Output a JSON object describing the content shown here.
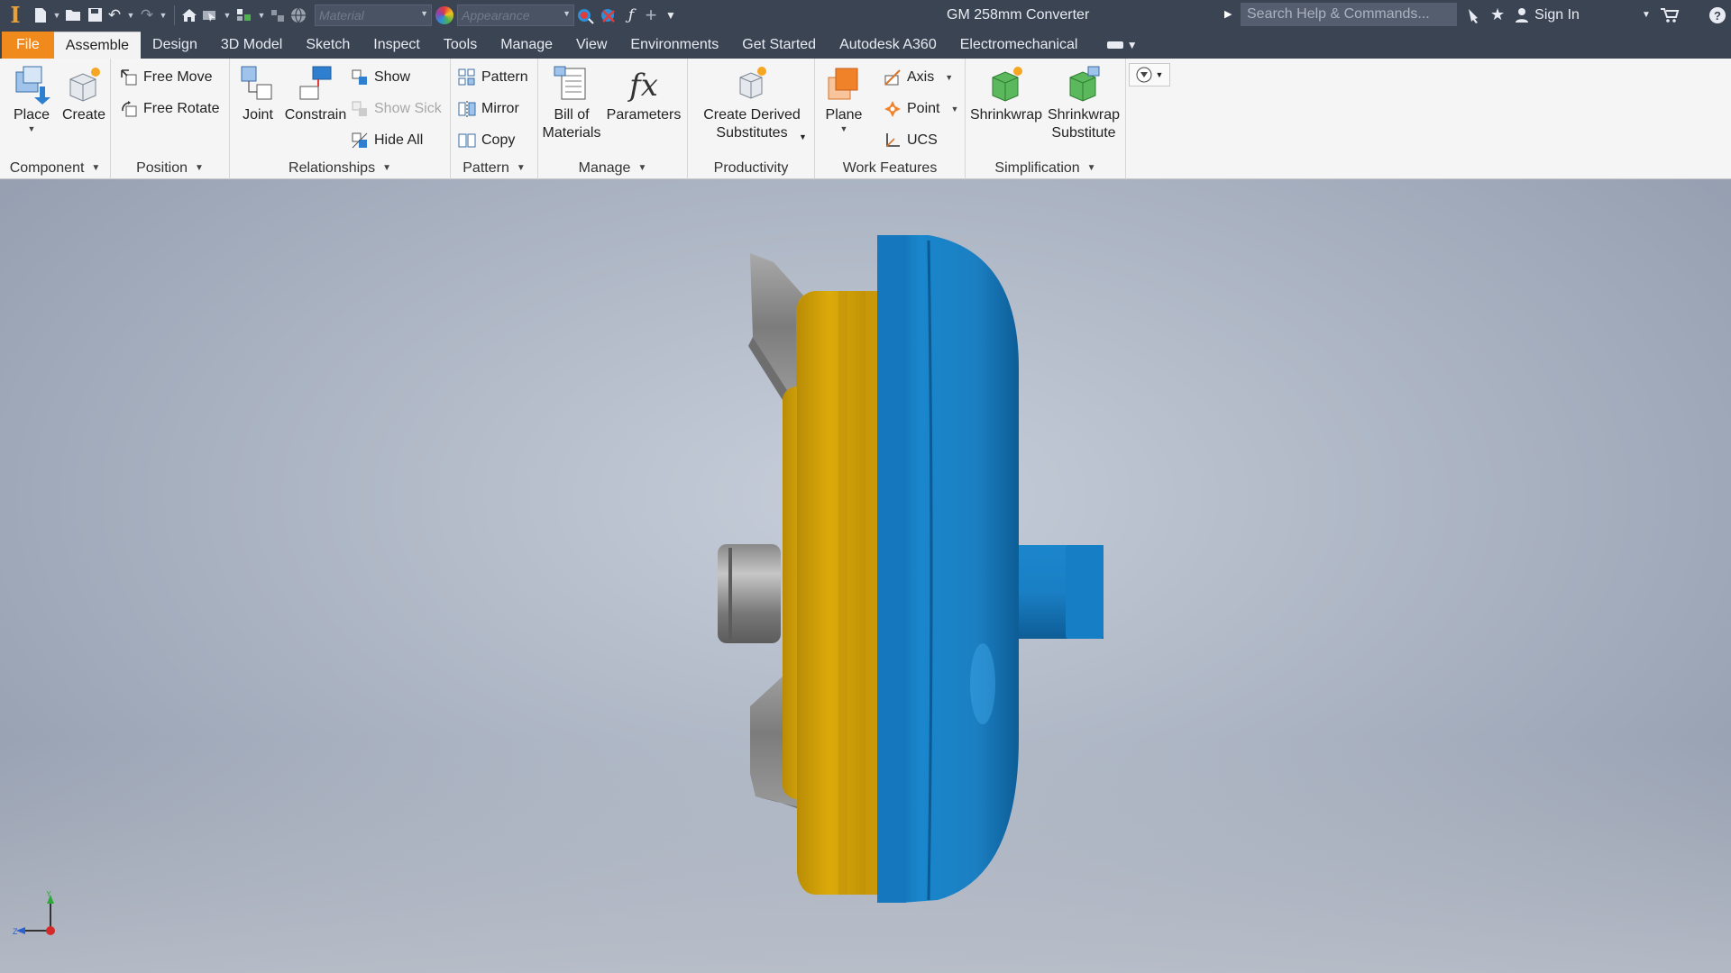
{
  "app": {
    "document_title": "GM 258mm Converter",
    "material_placeholder": "Material",
    "appearance_placeholder": "Appearance",
    "search_placeholder": "Search Help & Commands...",
    "sign_in_label": "Sign In"
  },
  "quick_access": [
    "new-icon",
    "open-icon",
    "save-icon",
    "undo-icon",
    "redo-icon",
    "home-icon",
    "select-icon",
    "measure-icon",
    "update-icon",
    "globe-icon"
  ],
  "tabs": [
    {
      "label": "File"
    },
    {
      "label": "Assemble"
    },
    {
      "label": "Design"
    },
    {
      "label": "3D Model"
    },
    {
      "label": "Sketch"
    },
    {
      "label": "Inspect"
    },
    {
      "label": "Tools"
    },
    {
      "label": "Manage"
    },
    {
      "label": "View"
    },
    {
      "label": "Environments"
    },
    {
      "label": "Get Started"
    },
    {
      "label": "Autodesk A360"
    },
    {
      "label": "Electromechanical"
    }
  ],
  "ribbon": {
    "component": {
      "title": "Component",
      "place": "Place",
      "create": "Create"
    },
    "position": {
      "title": "Position",
      "free_move": "Free Move",
      "free_rotate": "Free Rotate"
    },
    "relationships": {
      "title": "Relationships",
      "joint": "Joint",
      "constrain": "Constrain",
      "show": "Show",
      "show_sick": "Show Sick",
      "hide_all": "Hide All"
    },
    "pattern": {
      "title": "Pattern",
      "pattern": "Pattern",
      "mirror": "Mirror",
      "copy": "Copy"
    },
    "manage": {
      "title": "Manage",
      "bom_line1": "Bill of",
      "bom_line2": "Materials",
      "parameters": "Parameters"
    },
    "productivity": {
      "title": "Productivity",
      "cds_line1": "Create Derived",
      "cds_line2": "Substitutes"
    },
    "work_features": {
      "title": "Work Features",
      "plane": "Plane",
      "axis": "Axis",
      "point": "Point",
      "ucs": "UCS"
    },
    "simplification": {
      "title": "Simplification",
      "shrinkwrap": "Shrinkwrap",
      "sws_line1": "Shrinkwrap",
      "sws_line2": "Substitute"
    }
  },
  "viewcube_triad": {
    "y_label": "Y",
    "z_label": "Z"
  },
  "colors": {
    "titlebar": "#3b4453",
    "file_tab": "#f08a1c",
    "part_blue": "#1a7fc4",
    "part_yellow": "#d8a708",
    "part_gray": "#8e8e8e"
  }
}
